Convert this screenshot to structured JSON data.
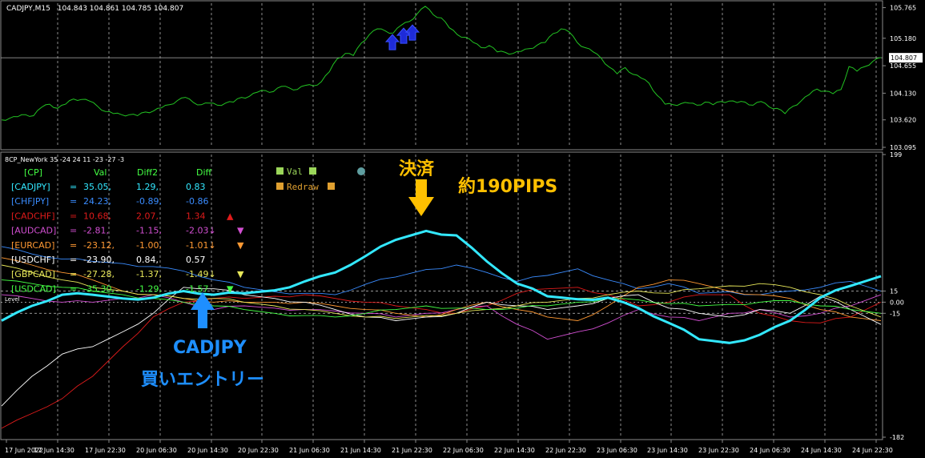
{
  "window": {
    "title": "CADJPY,M15",
    "ohlc": "104.843 104.861 104.785 104.807"
  },
  "colors": {
    "price_line": "#22c322",
    "cadjpy": "#33e8ff",
    "chfjpy": "#3a8cff",
    "cadchf": "#e01b1b",
    "audcad": "#d24fd2",
    "eurcad": "#ff9933",
    "usdchf": "#ffffff",
    "gbpcad": "#e8e85a",
    "usdcad": "#44ff44",
    "annot_yellow": "#ffc000",
    "annot_blue": "#1e8fff"
  },
  "chart_data": [
    {
      "type": "line",
      "name": "price",
      "title": "CADJPY,M15",
      "ylim": [
        103.095,
        105.85
      ],
      "yticks": [
        "105.765",
        "105.180",
        "104.655",
        "104.130",
        "103.620",
        "103.095"
      ],
      "current_price_label": "104.807",
      "series": [
        {
          "name": "CADJPY",
          "values": [
            103.62,
            103.65,
            103.68,
            103.72,
            103.7,
            103.86,
            103.92,
            103.84,
            103.92,
            104.02,
            104.01,
            103.98,
            103.88,
            103.78,
            103.74,
            103.72,
            103.72,
            103.7,
            103.77,
            103.79,
            103.85,
            103.91,
            103.99,
            104.05,
            103.95,
            103.91,
            103.94,
            103.9,
            103.94,
            103.96,
            104.05,
            104.07,
            104.15,
            104.18,
            104.16,
            104.26,
            104.23,
            104.2,
            104.28,
            104.27,
            104.35,
            104.54,
            104.79,
            104.89,
            104.85,
            105.09,
            105.25,
            105.36,
            105.32,
            105.28,
            105.43,
            105.5,
            105.65,
            105.79,
            105.63,
            105.57,
            105.38,
            105.25,
            105.2,
            105.1,
            105.0,
            105.04,
            104.92,
            104.91,
            104.89,
            104.93,
            104.98,
            105.05,
            105.1,
            105.27,
            105.36,
            105.3,
            105.1,
            105.0,
            104.92,
            104.8,
            104.63,
            104.5,
            104.62,
            104.49,
            104.42,
            104.32,
            104.09,
            103.92,
            103.91,
            103.93,
            103.94,
            103.9,
            103.96,
            103.91,
            103.97,
            103.98,
            103.95,
            103.96,
            103.9,
            103.97,
            103.87,
            103.84,
            103.74,
            103.88,
            103.98,
            104.1,
            104.21,
            104.17,
            104.12,
            104.2,
            104.64,
            104.55,
            104.64,
            104.74,
            104.81
          ]
        }
      ],
      "markers": [
        {
          "name": "buy-arrow-up",
          "value": 105.19
        }
      ]
    },
    {
      "type": "line",
      "title": "8CP_NewYork 35 -24 24 11 -23 -27 -3",
      "ylim": [
        -182,
        199
      ],
      "yticks": [
        "199",
        "15",
        "0.00",
        "-15",
        "-182"
      ],
      "categories": [
        "17 Jun 2022",
        "17 Jun 14:30",
        "17 Jun 22:30",
        "20 Jun 06:30",
        "20 Jun 14:30",
        "20 Jun 22:30",
        "21 Jun 06:30",
        "21 Jun 14:30",
        "21 Jun 22:30",
        "22 Jun 06:30",
        "22 Jun 14:30",
        "22 Jun 22:30",
        "23 Jun 06:30",
        "23 Jun 14:30",
        "23 Jun 22:30",
        "24 Jun 06:30",
        "24 Jun 14:30",
        "24 Jun 22:30"
      ],
      "series": [
        {
          "name": "CADJPY",
          "values": [
            -25,
            -5,
            10,
            10,
            5,
            6,
            15,
            10,
            12,
            16,
            28,
            40,
            62,
            84,
            96,
            90,
            55,
            25,
            8,
            4,
            6,
            -8,
            -28,
            -50,
            -55,
            -44,
            -25,
            6,
            22,
            35
          ]
        },
        {
          "name": "CHFJPY",
          "values": [
            75,
            65,
            58,
            55,
            52,
            48,
            42,
            30,
            20,
            14,
            12,
            10,
            24,
            34,
            44,
            50,
            40,
            28,
            36,
            45,
            30,
            18,
            25,
            12,
            14,
            10,
            15,
            20,
            28,
            15
          ]
        },
        {
          "name": "CADCHF",
          "values": [
            -170,
            -150,
            -130,
            -100,
            -60,
            -20,
            0,
            5,
            5,
            8,
            10,
            5,
            0,
            -5,
            -10,
            -15,
            -5,
            12,
            18,
            20,
            10,
            -5,
            0,
            10,
            10,
            -15,
            -25,
            -28,
            -20,
            0
          ]
        },
        {
          "name": "AUDCAD",
          "values": [
            10,
            5,
            0,
            0,
            5,
            10,
            0,
            -10,
            -5,
            -8,
            -10,
            -12,
            -15,
            -20,
            -15,
            -10,
            -5,
            -30,
            -50,
            -40,
            -28,
            -10,
            -20,
            -25,
            -15,
            -10,
            -20,
            -15,
            -5,
            10
          ]
        },
        {
          "name": "EURCAD",
          "values": [
            60,
            50,
            40,
            30,
            15,
            10,
            5,
            0,
            0,
            0,
            0,
            -5,
            -10,
            -15,
            -20,
            -10,
            0,
            -10,
            -20,
            -25,
            -5,
            20,
            30,
            25,
            15,
            10,
            5,
            -10,
            -20,
            -25
          ]
        },
        {
          "name": "USDCHF",
          "values": [
            -140,
            -100,
            -70,
            -60,
            -40,
            -15,
            20,
            18,
            10,
            5,
            0,
            -10,
            -20,
            -25,
            -20,
            -15,
            0,
            -5,
            -10,
            -5,
            5,
            10,
            -8,
            -15,
            -20,
            -10,
            -15,
            8,
            -10,
            -30
          ]
        },
        {
          "name": "GBPCAD",
          "values": [
            50,
            40,
            30,
            20,
            15,
            10,
            5,
            5,
            0,
            -5,
            -10,
            -15,
            -20,
            -22,
            -18,
            -15,
            -10,
            -5,
            0,
            5,
            10,
            15,
            12,
            18,
            22,
            25,
            20,
            10,
            -5,
            -20
          ]
        },
        {
          "name": "USDCAD",
          "values": [
            30,
            25,
            20,
            15,
            10,
            5,
            0,
            -5,
            -10,
            -15,
            -18,
            -20,
            -15,
            -10,
            -5,
            -8,
            -10,
            -8,
            -5,
            0,
            5,
            3,
            -2,
            -5,
            -3,
            0,
            2,
            -5,
            -10,
            -15
          ]
        }
      ],
      "levels": [
        15,
        0,
        -15
      ]
    }
  ],
  "table": {
    "headers": [
      "[CP]",
      "Val",
      "Diff2",
      "Diff"
    ],
    "rows": [
      {
        "name": "[CADJPY]",
        "sep": "=",
        "val": "35.05,",
        "diff2": "1.29,",
        "diff": "0.83",
        "mark": "",
        "color": "#33e8ff"
      },
      {
        "name": "[CHFJPY]",
        "sep": "=",
        "val": "24.23,",
        "diff2": "-0.89,",
        "diff": "-0.86",
        "mark": "",
        "color": "#3a8cff"
      },
      {
        "name": "[CADCHF]",
        "sep": "=",
        "val": "10.68,",
        "diff2": "2.07,",
        "diff": "1.34",
        "mark": "▲",
        "color": "#e01b1b"
      },
      {
        "name": "[AUDCAD]",
        "sep": "=",
        "val": "-2.81,",
        "diff2": "-1.15,",
        "diff": "-2.03↓",
        "mark": "▼",
        "color": "#d24fd2"
      },
      {
        "name": "[EURCAD]",
        "sep": "=",
        "val": "-23.12,",
        "diff2": "-1.00,",
        "diff": "-1.01↓",
        "mark": "▼",
        "color": "#ff9933"
      },
      {
        "name": "[USDCHF]",
        "sep": "=",
        "val": "-23.90,",
        "diff2": "0.84,",
        "diff": "0.57",
        "mark": "",
        "color": "#ffffff"
      },
      {
        "name": "[GBPCAD]",
        "sep": "=",
        "val": "-27.28,",
        "diff2": "-1.37,",
        "diff": "-1.49↓",
        "mark": "▼",
        "color": "#e8e85a"
      },
      {
        "name": "[USDCAD]",
        "sep": "=",
        "val": "-35.30,",
        "diff2": "-1.29,",
        "diff": "-1.57",
        "mark": "▼",
        "color": "#44ff44"
      }
    ]
  },
  "legend": {
    "val": "Val",
    "redraw": "Redraw"
  },
  "annotations": {
    "settle": "決済",
    "pips": "約190PIPS",
    "entry_line1": "CADJPY",
    "entry_line2": "買いエントリー"
  },
  "panel_left_label": "Level"
}
